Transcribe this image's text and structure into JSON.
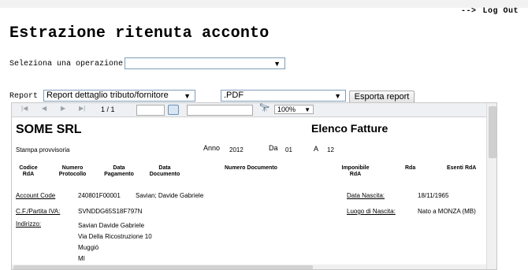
{
  "header": {
    "arrow": "-->",
    "logout_label": "Log Out"
  },
  "page": {
    "title": "Estrazione ritenuta acconto",
    "operation_label": "Seleziona una operazione",
    "operation_value": ""
  },
  "report_bar": {
    "label": "Report",
    "report_value": "Report dettaglio tributo/fornitore",
    "format_value": ".PDF",
    "export_label": "Esporta report"
  },
  "viewer": {
    "page_counter": "1 / 1",
    "zoom": "100%",
    "document": {
      "company": "SOME SRL",
      "report_name": "Elenco Fatture",
      "draft_label": "Stampa provvisoria",
      "year_label": "Anno",
      "year": "2012",
      "from_label": "Da",
      "from": "01",
      "to_label": "A",
      "to": "12",
      "columns": {
        "code_line1": "Codice",
        "code_line2": "RdA",
        "protocol_line1": "Numero",
        "protocol_line2": "Protocollo",
        "paydate_line1": "Data",
        "paydate_line2": "Pagamento",
        "docdate_line1": "Data",
        "docdate_line2": "Documento",
        "docnumber": "Numero Documento",
        "taxable_line1": "Imponibile",
        "taxable_line2": "RdA",
        "rda": "Rda",
        "exempt": "Esenti RdA"
      },
      "details": {
        "account_label": "Account Code",
        "account_value": "240801F00001",
        "account_name": "Savian; Davide Gabriele",
        "birth_date_label": "Data Nascita:",
        "birth_date": "18/11/1965",
        "tax_label": "C.F./Partita IVA:",
        "tax_value": "SVNDDG65S18F797N",
        "birth_place_label": "Luogo di Nascita:",
        "birth_place": "Nato a MONZA (MB)",
        "address_label": "Indirizzo:",
        "address_line1": "Savian Davide Gabriele",
        "address_line2": "Via Della Ricostruzione 10",
        "address_line3": "Muggiò",
        "address_line4": "MI"
      }
    }
  }
}
